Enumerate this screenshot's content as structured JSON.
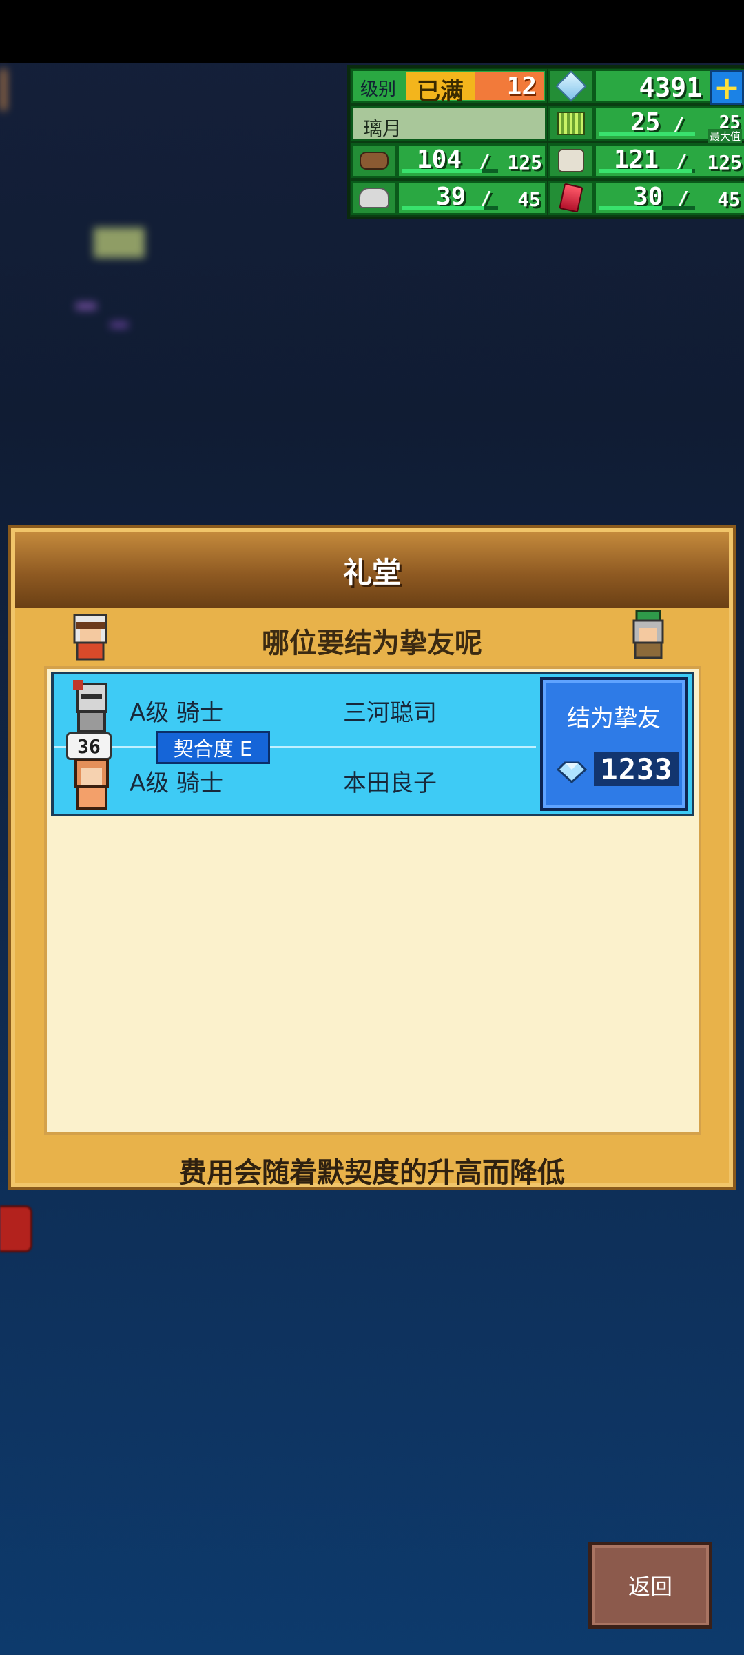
{
  "stats": {
    "level_label": "级别",
    "level_status": "已满",
    "level_value": "12",
    "gems": "4391",
    "name": "璃月",
    "grass_current": "25",
    "grass_max": "25",
    "grass_max_tag": "最大值",
    "wood_current": "104",
    "wood_max": "125",
    "animals_current": "121",
    "animals_max": "125",
    "stone_current": "39",
    "stone_max": "45",
    "ruby_current": "30",
    "ruby_max": "45"
  },
  "dialog": {
    "title": "礼堂",
    "subtitle": "哪位要结为挚友呢",
    "footer_note": "费用会随着默契度的升高而降低"
  },
  "pair": {
    "first": {
      "rank": "A级 骑士",
      "name": "三河聪司"
    },
    "second": {
      "rank": "A级 骑士",
      "name": "本田良子"
    },
    "affinity": "契合度 E",
    "badge": "36",
    "bond_label": "结为挚友",
    "bond_cost": "1233"
  },
  "back_button": "返回",
  "colors": {
    "stat_green": "#2aa842",
    "entry_blue": "#3ecbf5",
    "bond_button": "#2e7be7",
    "dialog_gold": "#e8b24a"
  }
}
